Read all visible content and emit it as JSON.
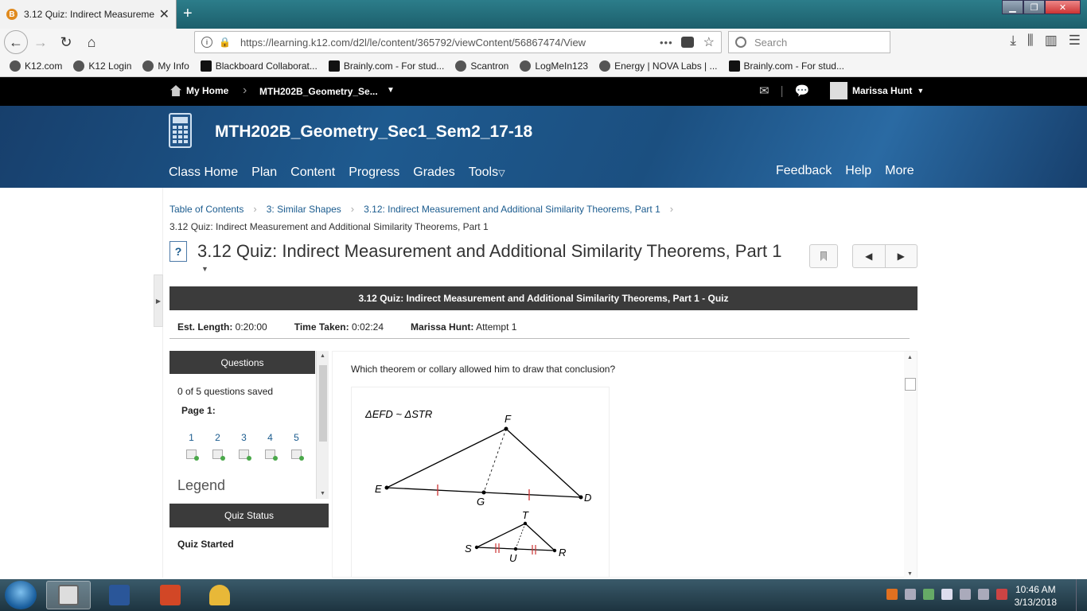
{
  "browser": {
    "tab_title": "3.12 Quiz: Indirect Measuremen",
    "url": "https://learning.k12.com/d2l/le/content/365792/viewContent/56867474/View",
    "url_dots": "•••",
    "search_placeholder": "Search",
    "bookmarks": [
      {
        "label": "K12.com",
        "icon": "globe-icon"
      },
      {
        "label": "K12 Login",
        "icon": "globe-icon"
      },
      {
        "label": "My Info",
        "icon": "globe-icon"
      },
      {
        "label": "Blackboard Collaborat...",
        "icon": "blackboard-icon"
      },
      {
        "label": "Brainly.com - For stud...",
        "icon": "brainly-icon"
      },
      {
        "label": "Scantron",
        "icon": "globe-icon"
      },
      {
        "label": "LogMeIn123",
        "icon": "globe-icon"
      },
      {
        "label": "Energy | NOVA Labs | ...",
        "icon": "nova-icon"
      },
      {
        "label": "Brainly.com - For stud...",
        "icon": "brainly-icon"
      }
    ]
  },
  "minibar": {
    "home": "My Home",
    "course": "MTH202B_Geometry_Se...",
    "user": "Marissa Hunt"
  },
  "banner": {
    "course_title": "MTH202B_Geometry_Sec1_Sem2_17-18",
    "nav": [
      "Class Home",
      "Plan",
      "Content",
      "Progress",
      "Grades",
      "Tools"
    ],
    "nav_right": [
      "Feedback",
      "Help",
      "More"
    ]
  },
  "breadcrumbs": [
    "Table of Contents",
    "3: Similar Shapes",
    "3.12: Indirect Measurement and Additional Similarity Theorems, Part 1"
  ],
  "subcrumb": "3.12 Quiz: Indirect Measurement and Additional Similarity Theorems, Part 1",
  "page_title": "3.12 Quiz: Indirect Measurement and Additional Similarity Theorems, Part 1",
  "quiz": {
    "header": "3.12 Quiz: Indirect Measurement and Additional Similarity Theorems, Part 1 - Quiz",
    "est_length_label": "Est. Length:",
    "est_length": "0:20:00",
    "time_taken_label": "Time Taken:",
    "time_taken": "0:02:24",
    "attempt_label": "Marissa Hunt:",
    "attempt": "Attempt 1",
    "questions_header": "Questions",
    "saved": "0 of 5 questions saved",
    "page_label": "Page 1:",
    "question_numbers": [
      "1",
      "2",
      "3",
      "4",
      "5"
    ],
    "legend": "Legend",
    "status_header": "Quiz Status",
    "status": "Quiz Started",
    "question_text": "Which theorem or collary allowed him to draw that conclusion?",
    "figure": {
      "relation": "ΔEFD ~ ΔSTR",
      "labels": [
        "F",
        "E",
        "G",
        "D",
        "T",
        "S",
        "U",
        "R"
      ]
    }
  },
  "taskbar": {
    "time": "10:46 AM",
    "date": "3/13/2018"
  }
}
